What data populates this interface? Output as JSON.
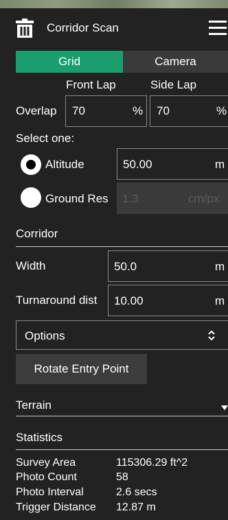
{
  "colors": {
    "accent": "#1a9e6e",
    "panel_bg": "#222222",
    "tab_inactive": "#3a3a3a",
    "button_bg": "#3c3c3c",
    "disabled_text": "#5c5c5c"
  },
  "header": {
    "title": "Corridor Scan",
    "icon": "trash-icon",
    "menu_icon": "hamburger-menu-icon"
  },
  "tabs": [
    {
      "label": "Grid",
      "active": true
    },
    {
      "label": "Camera",
      "active": false
    }
  ],
  "overlap": {
    "row_label": "Overlap",
    "front_lap_label": "Front Lap",
    "side_lap_label": "Side Lap",
    "front_lap_value": "70",
    "front_lap_unit": "%",
    "side_lap_value": "70",
    "side_lap_unit": "%"
  },
  "select_one": {
    "label": "Select one:",
    "altitude": {
      "label": "Altitude",
      "value": "50.00",
      "unit": "m",
      "selected": true
    },
    "ground_res": {
      "label": "Ground Res",
      "value": "1.3",
      "unit": "cm/px",
      "selected": false
    }
  },
  "corridor": {
    "section_label": "Corridor",
    "width_label": "Width",
    "width_value": "50.0",
    "width_unit": "m",
    "turnaround_label": "Turnaround dist",
    "turnaround_value": "10.00",
    "turnaround_unit": "m"
  },
  "options": {
    "label": "Options",
    "icon": "updown-chevron-icon"
  },
  "rotate_button": {
    "label": "Rotate Entry Point"
  },
  "terrain": {
    "label": "Terrain",
    "icon": "caret-down-icon"
  },
  "statistics": {
    "section_label": "Statistics",
    "rows": [
      {
        "label": "Survey Area",
        "value": "115306.29 ft^2"
      },
      {
        "label": "Photo Count",
        "value": "58"
      },
      {
        "label": "Photo Interval",
        "value": "2.6 secs"
      },
      {
        "label": "Trigger Distance",
        "value": "12.87 m"
      }
    ]
  }
}
